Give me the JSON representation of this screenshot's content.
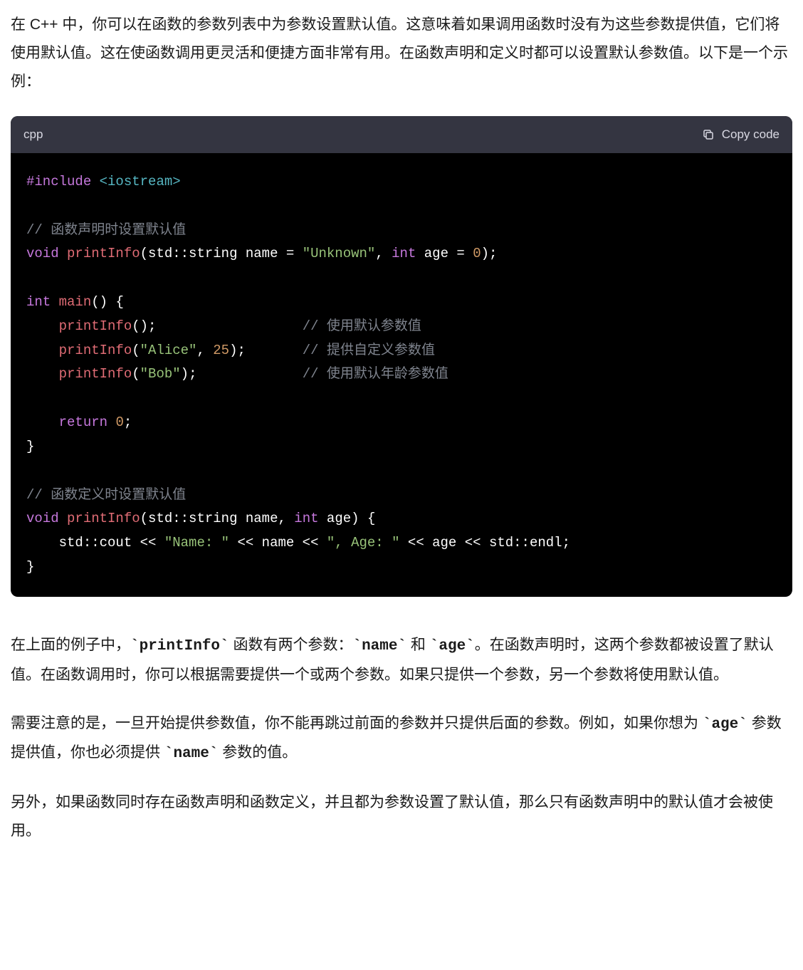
{
  "paragraphs": {
    "intro": "在 C++ 中，你可以在函数的参数列表中为参数设置默认值。这意味着如果调用函数时没有为这些参数提供值，它们将使用默认值。这在使函数调用更灵活和便捷方面非常有用。在函数声明和定义时都可以设置默认参数值。以下是一个示例：",
    "p2_part1": "在上面的例子中，",
    "p2_code1": "`printInfo`",
    "p2_part2": " 函数有两个参数：",
    "p2_code2": "`name`",
    "p2_part3": " 和 ",
    "p2_code3": "`age`",
    "p2_part4": "。在函数声明时，这两个参数都被设置了默认值。在函数调用时，你可以根据需要提供一个或两个参数。如果只提供一个参数，另一个参数将使用默认值。",
    "p3_part1": "需要注意的是，一旦开始提供参数值，你不能再跳过前面的参数并只提供后面的参数。例如，如果你想为 ",
    "p3_code1": "`age`",
    "p3_part2": " 参数提供值，你也必须提供 ",
    "p3_code2": "`name`",
    "p3_part3": " 参数的值。",
    "p4": "另外，如果函数同时存在函数声明和函数定义，并且都为参数设置了默认值，那么只有函数声明中的默认值才会被使用。"
  },
  "code": {
    "language": "cpp",
    "copy_label": "Copy code",
    "tokens": {
      "include_kw": "#include",
      "include_hdr": "<iostream>",
      "comment1": "// 函数声明时设置默认值",
      "void": "void",
      "printInfo": "printInfo",
      "lp": "(",
      "rp": ")",
      "sc": ";",
      "std_string": "std::string",
      "name": "name",
      "eq": " = ",
      "unknown_str": "\"Unknown\"",
      "comma": ", ",
      "int": "int",
      "age": "age",
      "zero": "0",
      "lb": " {",
      "rb": "}",
      "main": "main",
      "lp_rp": "()",
      "printInfo_call": "printInfo",
      "call1_pad": "                  ",
      "comment2": "// 使用默认参数值",
      "alice": "\"Alice\"",
      "twentyfive": "25",
      "call2_pad": "       ",
      "comment3": "// 提供自定义参数值",
      "indent": "    ",
      "bob": "\"Bob\"",
      "call3_pad": "             ",
      "comment4": "// 使用默认年龄参数值",
      "return": "return",
      "sp": " ",
      "comment5": "// 函数定义时设置默认值",
      "std_cout": "std::cout",
      "lt": " << ",
      "name_str": "\"Name: \"",
      "age_str": "\", Age: \"",
      "name_id": "name",
      "age_id": "age",
      "std_endl": "std::endl"
    }
  }
}
